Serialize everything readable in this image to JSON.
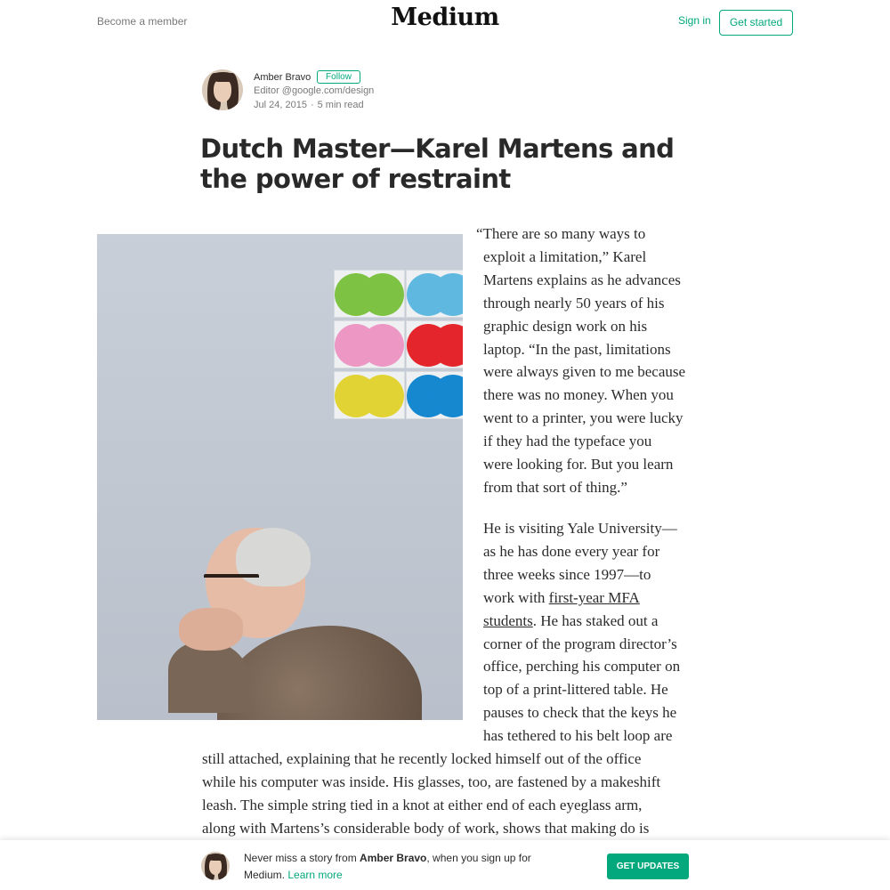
{
  "header": {
    "become_member": "Become a member",
    "logo": "Medium",
    "sign_in": "Sign in",
    "get_started": "Get started"
  },
  "author": {
    "name": "Amber Bravo",
    "follow_label": "Follow",
    "bio": "Editor @google.com/design",
    "date": "Jul 24, 2015",
    "read_time": "5 min read"
  },
  "article": {
    "title": "Dutch Master—Karel Martens and the power of restraint",
    "photo_icon": "portrait-photo",
    "para1_lines": [
      "“There are so many ways to",
      "exploit a limitation,” Karel",
      "Martens explains as he advances",
      "through nearly 50 years of his",
      "graphic design work on his",
      "laptop. “In the past, limitations",
      "were always given to me because",
      "there was no money. When you",
      "went to a printer, you were lucky",
      "if they had the typeface you",
      "were looking for. But you learn",
      "from that sort of thing.”"
    ],
    "para2": {
      "l1": "He is visiting Yale University—",
      "l2": "as he has done every year for",
      "l3": "three weeks since 1997—to",
      "l4_pre": "work with ",
      "link_a": "first-year MFA",
      "link_b": "students",
      "l5_post": ". He has staked out a",
      "l6": "corner of the program director’s",
      "l7": "office, perching his computer on",
      "l8": "top of a print-littered table. He",
      "l9": "pauses to check that the keys he",
      "l10": "has tethered to his belt loop are"
    },
    "para3_lines": [
      "still attached, explaining that he recently locked himself out of the office",
      "while his computer was inside. His glasses, too, are fastened by a makeshift",
      "leash. The simple string tied in a knot at either end of each eyeglass arm,",
      "along with Martens’s considerable body of work, shows that making do is"
    ]
  },
  "bottom_bar": {
    "text_pre": "Never miss a story from ",
    "author": "Amber Bravo",
    "text_post": ", when you sign up for",
    "text_line2": "Medium. ",
    "learn_more": "Learn more",
    "button": "GET UPDATES"
  },
  "colors": {
    "accent": "#03a87c",
    "text": "#000000d6",
    "muted": "#0000008a"
  }
}
